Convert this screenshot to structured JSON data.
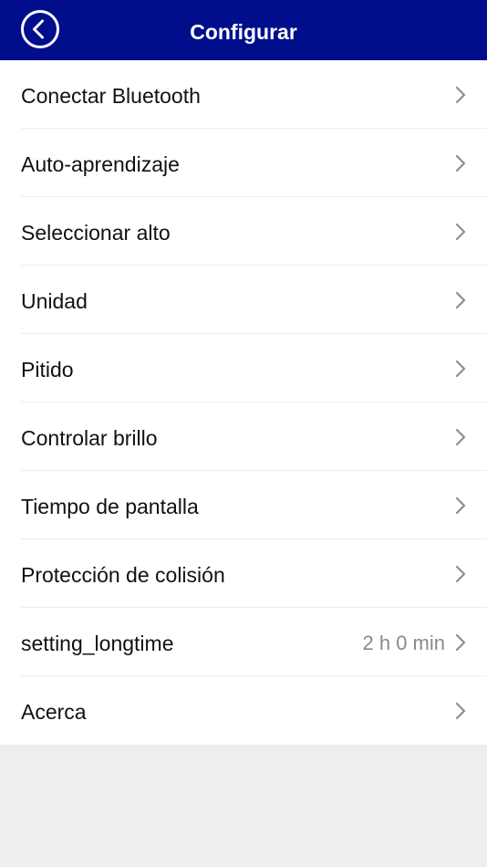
{
  "header": {
    "title": "Configurar",
    "back_icon": "chevron-left-circle-icon",
    "background_color": "#000e8c",
    "text_color": "#ffffff"
  },
  "settings": {
    "items": [
      {
        "label": "Conectar Bluetooth",
        "value": ""
      },
      {
        "label": "Auto-aprendizaje",
        "value": ""
      },
      {
        "label": "Seleccionar alto",
        "value": ""
      },
      {
        "label": "Unidad",
        "value": ""
      },
      {
        "label": "Pitido",
        "value": ""
      },
      {
        "label": "Controlar brillo",
        "value": ""
      },
      {
        "label": "Tiempo de pantalla",
        "value": ""
      },
      {
        "label": "Protección de colisión",
        "value": ""
      },
      {
        "label": "setting_longtime",
        "value": "2 h 0 min"
      },
      {
        "label": "Acerca",
        "value": ""
      }
    ],
    "row_icon": "chevron-right-icon"
  }
}
